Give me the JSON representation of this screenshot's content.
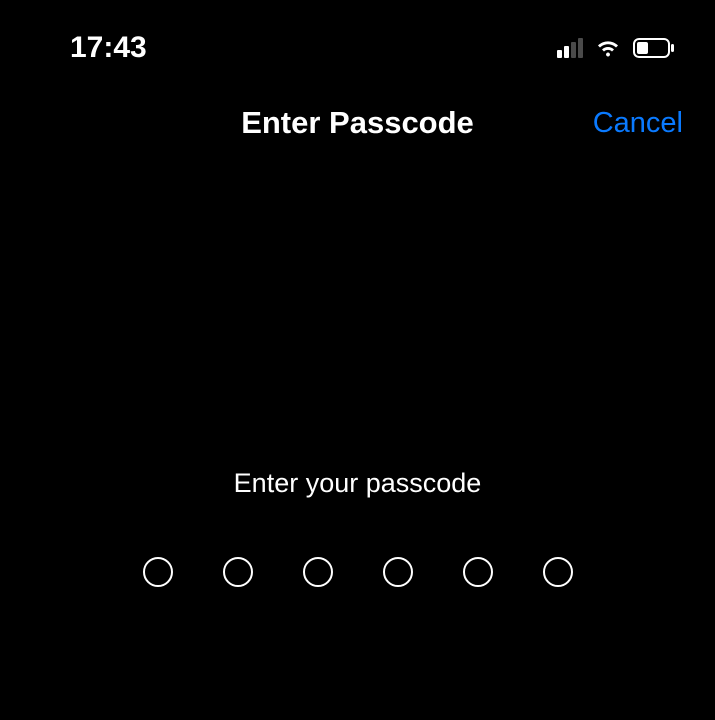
{
  "status_bar": {
    "time": "17:43",
    "cellular_signal": 2,
    "cellular_total": 4,
    "wifi_active": true,
    "battery_level": 0.35
  },
  "nav": {
    "title": "Enter Passcode",
    "cancel_label": "Cancel"
  },
  "content": {
    "prompt": "Enter your passcode",
    "passcode_length": 6,
    "digits_entered": 0
  },
  "colors": {
    "accent": "#0a7aff",
    "background": "#000000",
    "foreground": "#ffffff"
  }
}
